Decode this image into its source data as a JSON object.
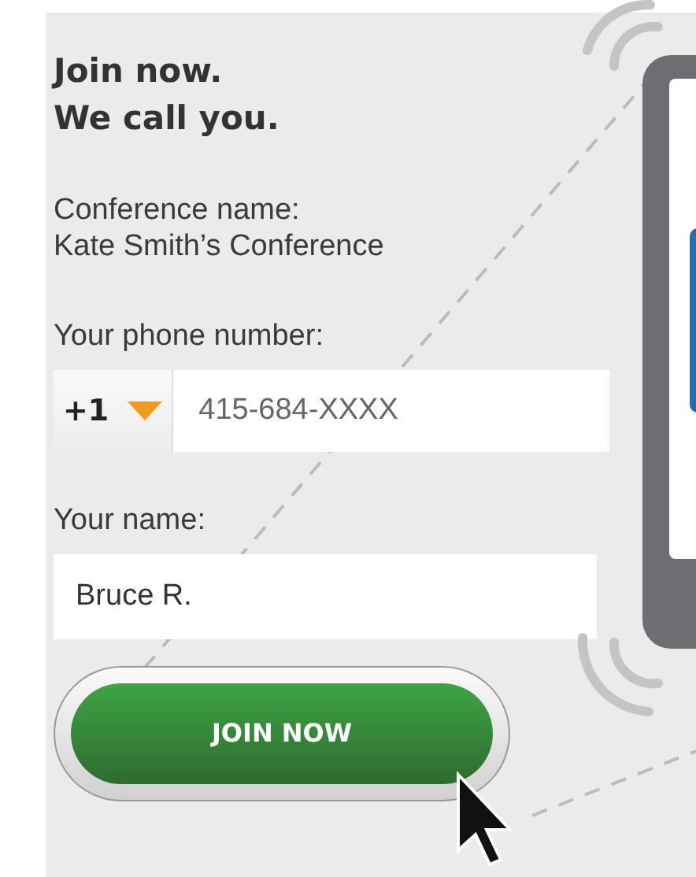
{
  "heading": [
    "Join now.",
    "We call you."
  ],
  "conference": {
    "label": "Conference name:",
    "value": "Kate Smith’s Conference"
  },
  "phone": {
    "label": "Your phone number:",
    "country_code": "+1",
    "placeholder": "415-684-XXXX"
  },
  "name": {
    "label": "Your name:",
    "value": "Bruce R."
  },
  "button": {
    "label": "JOIN NOW"
  }
}
